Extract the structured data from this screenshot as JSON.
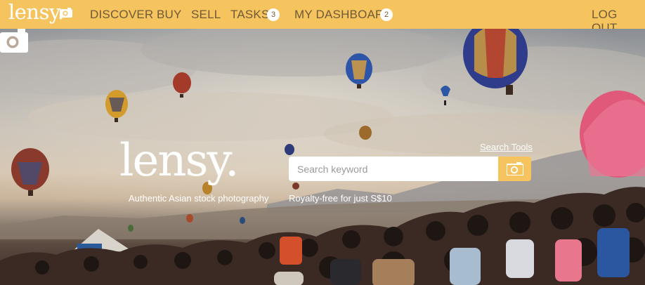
{
  "nav": {
    "logo_text": "lensy.",
    "items": [
      {
        "label": "DISCOVER"
      },
      {
        "label": "BUY"
      },
      {
        "label": "SELL"
      },
      {
        "label": "TASKS",
        "badge": "3"
      },
      {
        "label": "MY DASHBOARD",
        "badge": "2"
      }
    ],
    "logout_label": "LOG OUT"
  },
  "hero": {
    "logo_text": "lensy.",
    "tagline": "Authentic Asian stock photography",
    "price_text": "Royalty-free for just S$10",
    "search_tools_label": "Search Tools",
    "search_placeholder": "Search keyword"
  },
  "icons": {
    "logo_icon": "camera-icon",
    "search_button_icon": "camera-icon"
  },
  "colors": {
    "brand": "#f6c45f",
    "nav_text": "#6f5a37"
  }
}
